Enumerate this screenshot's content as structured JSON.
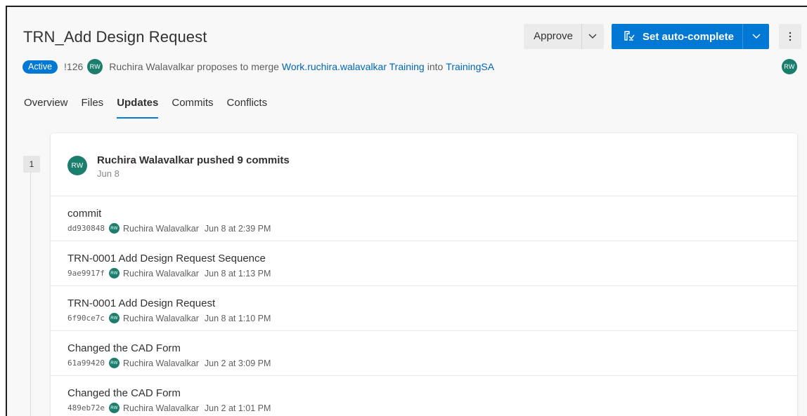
{
  "pr": {
    "title": "TRN_Add Design Request",
    "status": "Active",
    "id": "!126",
    "author_initials": "RW",
    "author": "Ruchira Walavalkar",
    "proposes_text": "proposes to merge",
    "source_branch": "Work.ruchira.walavalkar Training",
    "into_text": "into",
    "target_branch": "TrainingSA"
  },
  "actions": {
    "approve_label": "Approve",
    "auto_complete_label": "Set auto-complete"
  },
  "tabs": [
    {
      "label": "Overview",
      "selected": false
    },
    {
      "label": "Files",
      "selected": false
    },
    {
      "label": "Updates",
      "selected": true
    },
    {
      "label": "Commits",
      "selected": false
    },
    {
      "label": "Conflicts",
      "selected": false
    }
  ],
  "update": {
    "step": "1",
    "summary": "Ruchira Walavalkar pushed 9 commits",
    "date": "Jun 8",
    "commits": [
      {
        "message": "commit",
        "hash": "dd930848",
        "author": "Ruchira Walavalkar",
        "time": "Jun 8 at 2:39 PM"
      },
      {
        "message": "TRN-0001 Add Design Request Sequence",
        "hash": "9ae9917f",
        "author": "Ruchira Walavalkar",
        "time": "Jun 8 at 1:13 PM"
      },
      {
        "message": "TRN-0001 Add Design Request",
        "hash": "6f90ce7c",
        "author": "Ruchira Walavalkar",
        "time": "Jun 8 at 1:10 PM"
      },
      {
        "message": "Changed the CAD Form",
        "hash": "61a99420",
        "author": "Ruchira Walavalkar",
        "time": "Jun 2 at 3:09 PM"
      },
      {
        "message": "Changed the CAD Form",
        "hash": "489eb72e",
        "author": "Ruchira Walavalkar",
        "time": "Jun 2 at 1:01 PM"
      }
    ]
  },
  "colors": {
    "accent": "#0078d4",
    "avatar": "#1b7e6d",
    "link": "#0066b8"
  }
}
